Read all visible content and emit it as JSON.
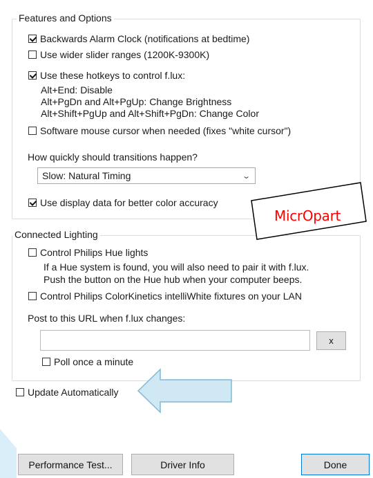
{
  "features": {
    "title": "Features and Options",
    "backwards_alarm": {
      "label": "Backwards Alarm Clock (notifications at bedtime)",
      "checked": true
    },
    "wider_slider": {
      "label": "Use wider slider ranges (1200K-9300K)",
      "checked": false
    },
    "hotkeys": {
      "label": "Use these hotkeys to control f.lux:",
      "checked": true
    },
    "hotkey_lines": [
      "Alt+End: Disable",
      "Alt+PgDn and Alt+PgUp: Change Brightness",
      "Alt+Shift+PgUp and Alt+Shift+PgDn: Change Color"
    ],
    "software_cursor": {
      "label": "Software mouse cursor when needed (fixes \"white cursor\")",
      "checked": false
    },
    "transition_question": "How quickly should transitions happen?",
    "transition_select": "Slow: Natural Timing",
    "display_data": {
      "label": "Use display data for better color accuracy",
      "checked": true
    }
  },
  "lighting": {
    "title": "Connected Lighting",
    "hue": {
      "label": "Control Philips Hue lights",
      "checked": false
    },
    "hue_help": [
      "If a Hue system is found, you will also need to pair it with f.lux.",
      "Push the button on the Hue hub when your computer beeps."
    ],
    "colorkinetics": {
      "label": "Control Philips ColorKinetics intelliWhite fixtures on your LAN",
      "checked": false
    },
    "post_url_label": "Post to this URL when f.lux changes:",
    "post_url_value": "",
    "clear_button": "x",
    "poll": {
      "label": "Poll once a minute",
      "checked": false
    }
  },
  "update_auto": {
    "label": "Update Automatically",
    "checked": false
  },
  "annotation": {
    "label": "MicrOpart"
  },
  "buttons": {
    "performance": "Performance Test...",
    "driver": "Driver Info",
    "done": "Done"
  },
  "colors": {
    "accent_border": "#0078d7",
    "annotation_text": "#ff0000",
    "arrow_fill": "#cfe8f3"
  }
}
